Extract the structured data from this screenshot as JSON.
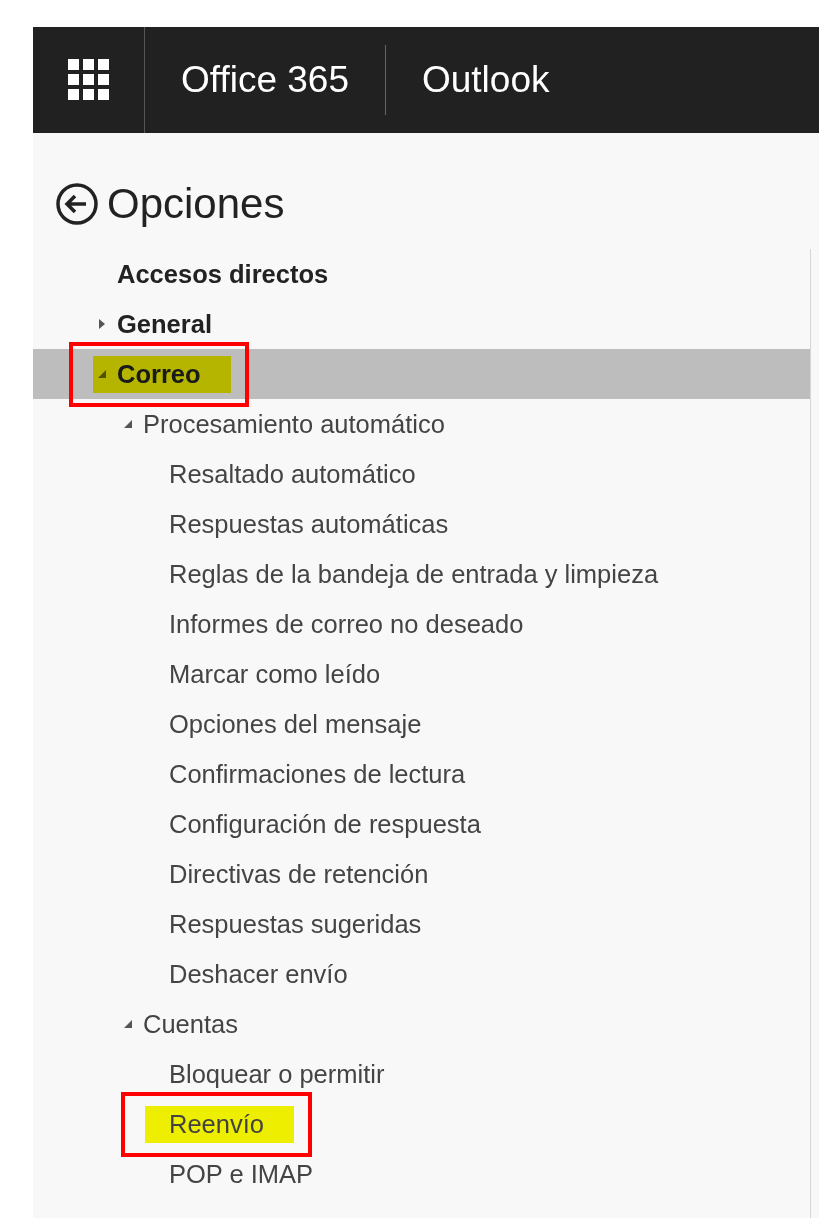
{
  "top_bar": {
    "brand": "Office 365",
    "app": "Outlook"
  },
  "page": {
    "title": "Opciones"
  },
  "nav": [
    {
      "label": "Accesos directos",
      "selected": false,
      "annotated": false
    },
    {
      "label": "General",
      "expanded": false,
      "selected": false,
      "annotated": false
    },
    {
      "label": "Correo",
      "expanded": true,
      "selected": true,
      "annotated": true,
      "children": [
        {
          "label": "Procesamiento automático",
          "expanded": true,
          "selected": false,
          "annotated": false,
          "children": [
            {
              "label": "Resaltado automático",
              "selected": false,
              "annotated": false
            },
            {
              "label": "Respuestas automáticas",
              "selected": false,
              "annotated": false
            },
            {
              "label": "Reglas de la bandeja de entrada y limpieza",
              "selected": false,
              "annotated": false
            },
            {
              "label": "Informes de correo no deseado",
              "selected": false,
              "annotated": false
            },
            {
              "label": "Marcar como leído",
              "selected": false,
              "annotated": false
            },
            {
              "label": "Opciones del mensaje",
              "selected": false,
              "annotated": false
            },
            {
              "label": "Confirmaciones de lectura",
              "selected": false,
              "annotated": false
            },
            {
              "label": "Configuración de respuesta",
              "selected": false,
              "annotated": false
            },
            {
              "label": "Directivas de retención",
              "selected": false,
              "annotated": false
            },
            {
              "label": "Respuestas sugeridas",
              "selected": false,
              "annotated": false
            },
            {
              "label": "Deshacer envío",
              "selected": false,
              "annotated": false
            }
          ]
        },
        {
          "label": "Cuentas",
          "expanded": true,
          "selected": false,
          "annotated": false,
          "children": [
            {
              "label": "Bloquear o permitir",
              "selected": false,
              "annotated": false
            },
            {
              "label": "Reenvío",
              "selected": false,
              "annotated": true
            },
            {
              "label": "POP e IMAP",
              "selected": false,
              "annotated": false
            }
          ]
        }
      ]
    }
  ]
}
